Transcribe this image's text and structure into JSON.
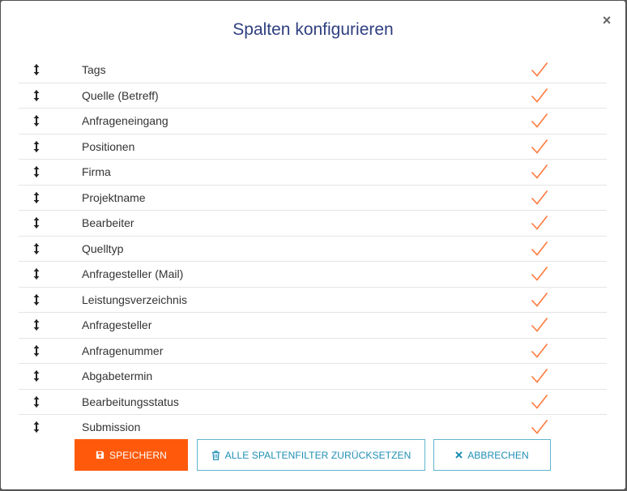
{
  "dialog": {
    "title": "Spalten konfigurieren",
    "close_glyph": "×"
  },
  "columns": [
    {
      "label": "Tags",
      "checked": true
    },
    {
      "label": "Quelle (Betreff)",
      "checked": true
    },
    {
      "label": "Anfrageneingang",
      "checked": true
    },
    {
      "label": "Positionen",
      "checked": true
    },
    {
      "label": "Firma",
      "checked": true
    },
    {
      "label": "Projektname",
      "checked": true
    },
    {
      "label": "Bearbeiter",
      "checked": true
    },
    {
      "label": "Quelltyp",
      "checked": true
    },
    {
      "label": "Anfragesteller (Mail)",
      "checked": true
    },
    {
      "label": "Leistungsverzeichnis",
      "checked": true
    },
    {
      "label": "Anfragesteller",
      "checked": true
    },
    {
      "label": "Anfragenummer",
      "checked": true
    },
    {
      "label": "Abgabetermin",
      "checked": true
    },
    {
      "label": "Bearbeitungsstatus",
      "checked": true
    },
    {
      "label": "Submission",
      "checked": true
    }
  ],
  "buttons": {
    "save_label": "SPEICHERN",
    "reset_label": "ALLE SPALTENFILTER ZURÜCKSETZEN",
    "cancel_label": "ABBRECHEN"
  },
  "icons": {
    "drag": "vertical-arrows-icon",
    "check": "checkmark-icon",
    "save": "floppy-disk-icon",
    "reset": "trash-icon",
    "cancel": "x-icon"
  },
  "colors": {
    "title": "#2f3f80",
    "accent": "#ff5a0c",
    "secondary": "#1f8fb5",
    "check": "#ff7a3d"
  }
}
